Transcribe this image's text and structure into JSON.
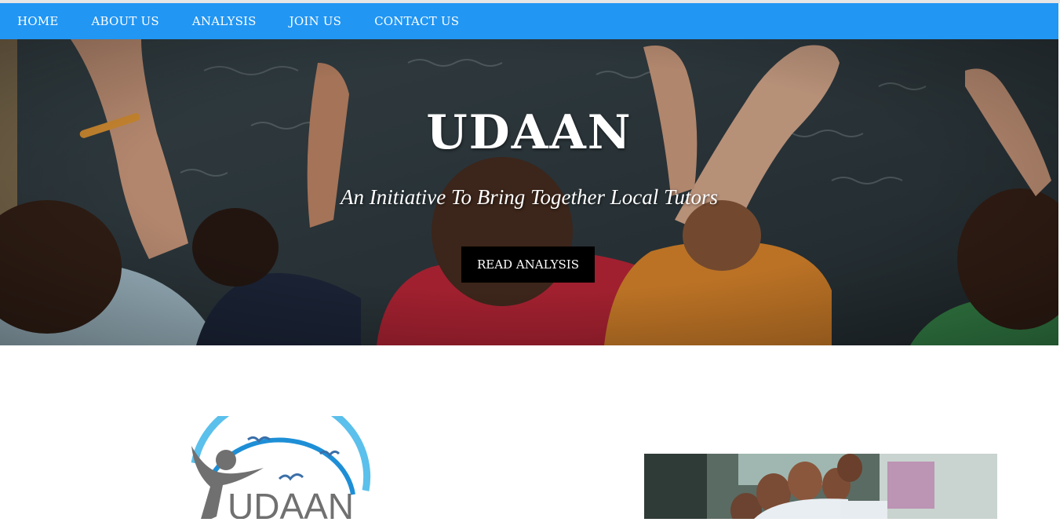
{
  "nav": {
    "items": [
      {
        "label": "HOME"
      },
      {
        "label": "ABOUT US"
      },
      {
        "label": "ANALYSIS"
      },
      {
        "label": "JOIN US"
      },
      {
        "label": "CONTACT US"
      }
    ]
  },
  "hero": {
    "title": "UDAAN",
    "subtitle": "An Initiative To Bring Together Local Tutors",
    "button_label": "READ ANALYSIS"
  },
  "logo": {
    "text": "UDAAN"
  },
  "colors": {
    "navbar": "#2196f3",
    "button": "#000000",
    "logo_arc": "#5bc0eb",
    "logo_figure": "#707070"
  }
}
